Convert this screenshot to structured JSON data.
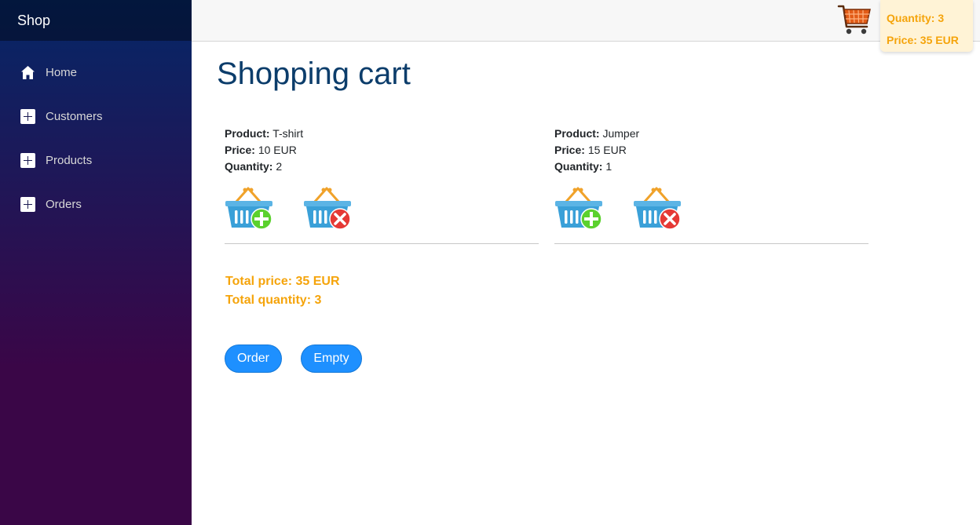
{
  "brand": {
    "title": "Shop"
  },
  "sidebar": {
    "items": [
      {
        "label": "Home",
        "icon": "home-icon"
      },
      {
        "label": "Customers",
        "icon": "plus-box-icon"
      },
      {
        "label": "Products",
        "icon": "plus-box-icon"
      },
      {
        "label": "Orders",
        "icon": "plus-box-icon"
      }
    ]
  },
  "header": {
    "cart_icon": "shopping-cart-icon",
    "quantity_text": "Quantity: 3",
    "price_text": "Price: 35 EUR"
  },
  "main": {
    "title": "Shopping cart",
    "labels": {
      "product": "Product:",
      "price": "Price:",
      "quantity": "Quantity:"
    },
    "products": [
      {
        "name": "T-shirt",
        "price": "10 EUR",
        "quantity": "2"
      },
      {
        "name": "Jumper",
        "price": "15 EUR",
        "quantity": "1"
      }
    ],
    "total_price": "Total price: 35 EUR",
    "total_quantity": "Total quantity: 3",
    "order_label": "Order",
    "empty_label": "Empty"
  },
  "colors": {
    "accent": "#f5a40b",
    "button": "#1e90ff",
    "title": "#0c3d6b",
    "sidebar_top": "#052767",
    "sidebar_bottom": "#3a0647"
  }
}
